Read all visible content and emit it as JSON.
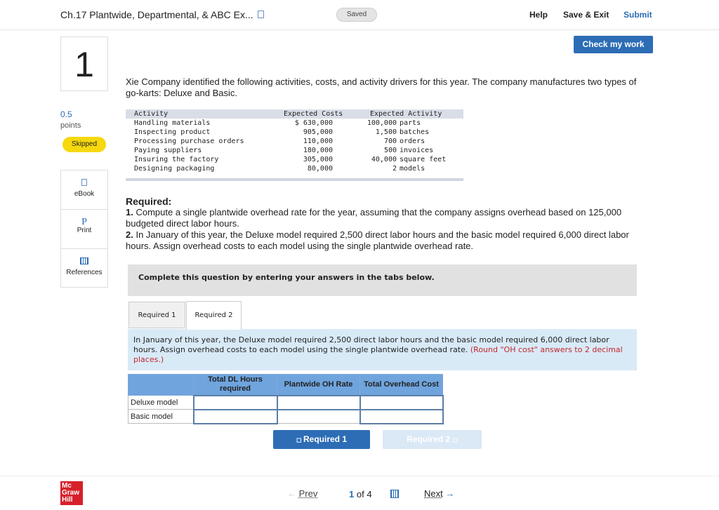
{
  "header": {
    "title": "Ch.17 Plantwide, Departmental, & ABC Ex...",
    "status": "Saved",
    "help": "Help",
    "save_exit": "Save & Exit",
    "submit": "Submit",
    "check": "Check my work"
  },
  "question": {
    "number": "1",
    "points": "0.5",
    "points_label": "points",
    "state": "Skipped"
  },
  "tools": [
    {
      "icon": "ebook-icon",
      "label": "eBook"
    },
    {
      "icon": "print-icon",
      "label": "Print"
    },
    {
      "icon": "references-icon",
      "label": "References"
    }
  ],
  "intro": "Xie Company identified the following activities, costs, and activity drivers for this year. The company manufactures two types of go-karts: Deluxe and Basic.",
  "activity_table": {
    "headers": [
      "Activity",
      "Expected Costs",
      "Expected Activity"
    ],
    "rows": [
      [
        "Handling materials",
        "$ 630,000",
        "100,000",
        "parts"
      ],
      [
        "Inspecting product",
        "905,000",
        "1,500",
        "batches"
      ],
      [
        "Processing purchase orders",
        "110,000",
        "700",
        "orders"
      ],
      [
        "Paying suppliers",
        "180,000",
        "500",
        "invoices"
      ],
      [
        "Insuring the factory",
        "305,000",
        "40,000",
        "square feet"
      ],
      [
        "Designing packaging",
        "80,000",
        "2",
        "models"
      ]
    ]
  },
  "required": {
    "heading": "Required:",
    "item1_num": "1.",
    "item1": " Compute a single plantwide overhead rate for the year, assuming that the company assigns overhead based on 125,000 budgeted direct labor hours.",
    "item2_num": "2.",
    "item2": " In January of this year, the Deluxe model required 2,500 direct labor hours and the basic model required 6,000 direct labor hours. Assign overhead costs to each model using the single plantwide overhead rate."
  },
  "banner": "Complete this question by entering your answers in the tabs below.",
  "tabs": [
    "Required 1",
    "Required 2"
  ],
  "instruction": "In January of this year, the Deluxe model required 2,500 direct labor hours and the basic model required 6,000 direct labor hours. Assign overhead costs to each model using the single plantwide overhead rate.",
  "instruction_note": "(Round \"OH cost\" answers to 2 decimal places.)",
  "answer_table": {
    "headers": [
      "",
      "Total DL Hours required",
      "Plantwide OH Rate",
      "Total Overhead Cost"
    ],
    "rows": [
      "Deluxe model",
      "Basic model"
    ]
  },
  "nav_buttons": {
    "prev": "Required 1",
    "next": "Required 2"
  },
  "footer": {
    "logo": "Mc Graw Hill",
    "prev": "Prev",
    "page": "1",
    "of": "of",
    "total": "4",
    "next": "Next"
  }
}
